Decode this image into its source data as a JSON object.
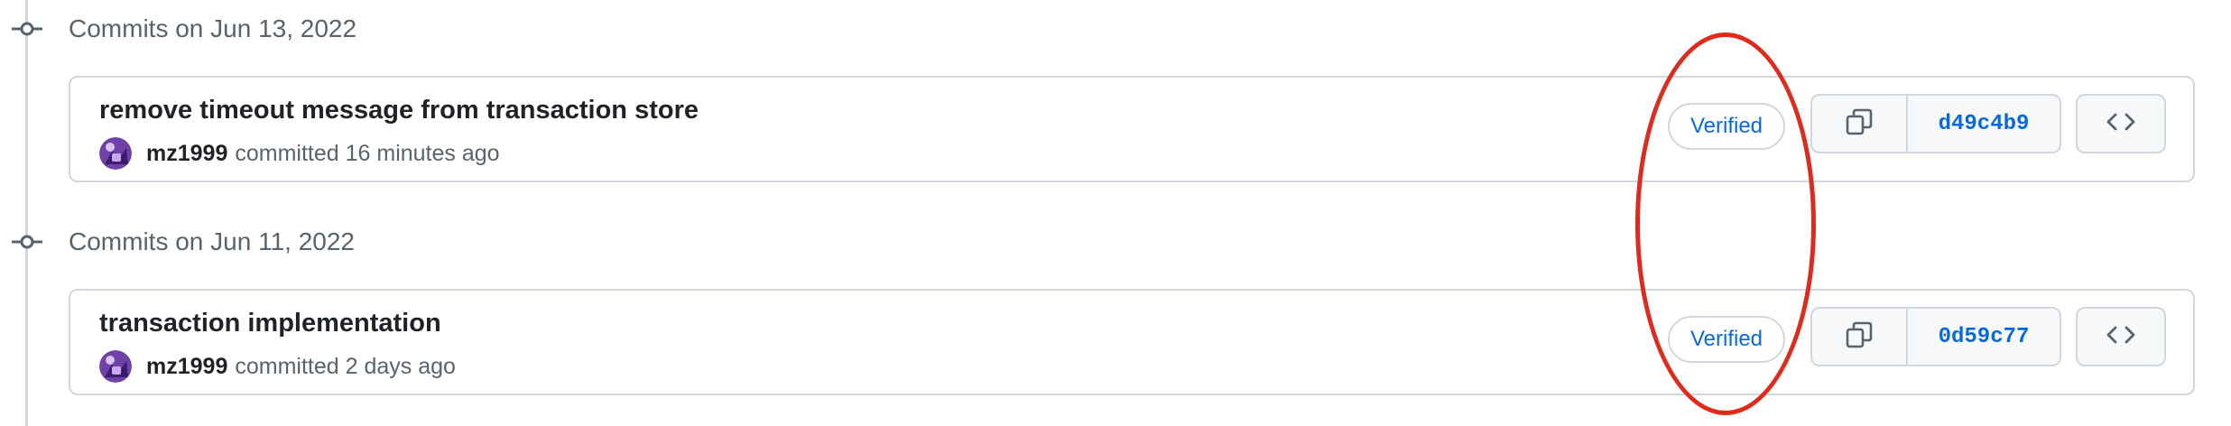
{
  "timeline": {
    "groups": [
      {
        "label": "Commits on Jun 13, 2022",
        "commit": {
          "title": "remove timeout message from transaction store",
          "author": "mz1999",
          "time_text": "committed 16 minutes ago",
          "verified_label": "Verified",
          "sha": "d49c4b9"
        }
      },
      {
        "label": "Commits on Jun 11, 2022",
        "commit": {
          "title": "transaction implementation",
          "author": "mz1999",
          "time_text": "committed 2 days ago",
          "verified_label": "Verified",
          "sha": "0d59c77"
        }
      }
    ]
  },
  "icons": {
    "commit_node": "git-commit-icon",
    "copy": "copy-icon",
    "browse": "code-icon",
    "avatar": "user-avatar"
  },
  "colors": {
    "link_blue": "#0969da",
    "border": "#d0d7de",
    "muted_text": "#59636e",
    "annotation_red": "#e02a1c"
  }
}
